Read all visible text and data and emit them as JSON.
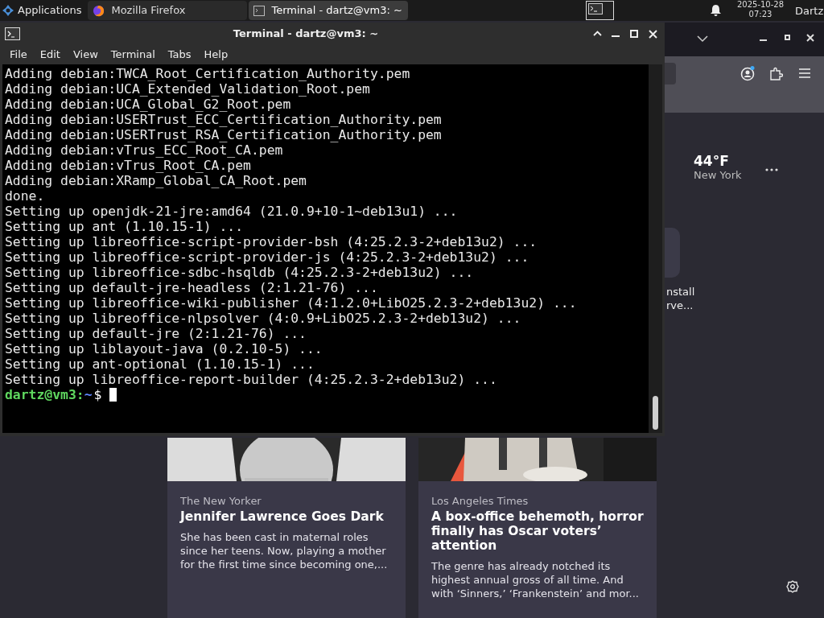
{
  "taskbar": {
    "apps_menu": "Applications",
    "tasks": [
      {
        "label": "Mozilla Firefox",
        "kind": "browser",
        "selected": false
      },
      {
        "label": "Terminal - dartz@vm3: ~",
        "kind": "terminal",
        "selected": true
      }
    ],
    "date": "2025-10-28",
    "time": "07:23",
    "user": "Dartz"
  },
  "terminal": {
    "title": "Terminal - dartz@vm3: ~",
    "menu": [
      "File",
      "Edit",
      "View",
      "Terminal",
      "Tabs",
      "Help"
    ],
    "lines": [
      "Adding debian:TWCA_Root_Certification_Authority.pem",
      "Adding debian:UCA_Extended_Validation_Root.pem",
      "Adding debian:UCA_Global_G2_Root.pem",
      "Adding debian:USERTrust_ECC_Certification_Authority.pem",
      "Adding debian:USERTrust_RSA_Certification_Authority.pem",
      "Adding debian:vTrus_ECC_Root_CA.pem",
      "Adding debian:vTrus_Root_CA.pem",
      "Adding debian:XRamp_Global_CA_Root.pem",
      "done.",
      "Setting up openjdk-21-jre:amd64 (21.0.9+10-1~deb13u1) ...",
      "Setting up ant (1.10.15-1) ...",
      "Setting up libreoffice-script-provider-bsh (4:25.2.3-2+deb13u2) ...",
      "Setting up libreoffice-script-provider-js (4:25.2.3-2+deb13u2) ...",
      "Setting up libreoffice-sdbc-hsqldb (4:25.2.3-2+deb13u2) ...",
      "Setting up default-jre-headless (2:1.21-76) ...",
      "Setting up libreoffice-wiki-publisher (4:1.2.0+LibO25.2.3-2+deb13u2) ...",
      "Setting up libreoffice-nlpsolver (4:0.9+LibO25.2.3-2+deb13u2) ...",
      "Setting up default-jre (2:1.21-76) ...",
      "Setting up liblayout-java (0.2.10-5) ...",
      "Setting up ant-optional (1.10.15-1) ...",
      "Setting up libreoffice-report-builder (4:25.2.3-2+deb13u2) ..."
    ],
    "prompt": {
      "user": "dartz@vm3:",
      "dir": "~",
      "symbol": "$"
    }
  },
  "browser": {
    "weather": {
      "temp": "44°F",
      "city": "New York"
    },
    "shortcut": {
      "lines": [
        "nstall",
        "rve..."
      ]
    },
    "cards": [
      {
        "source": "The New Yorker",
        "title": "Jennifer Lawrence Goes Dark",
        "summary": "She has been cast in maternal roles since her teens. Now, playing a mother for the first time since becoming one,..."
      },
      {
        "source": "Los Angeles Times",
        "title": "A box-office behemoth, horror finally has Oscar voters’ attention",
        "summary": "The genre has already notched its highest annual gross of all time. And with ‘Sinners,’ ‘Frankenstein’ and mor..."
      }
    ]
  }
}
